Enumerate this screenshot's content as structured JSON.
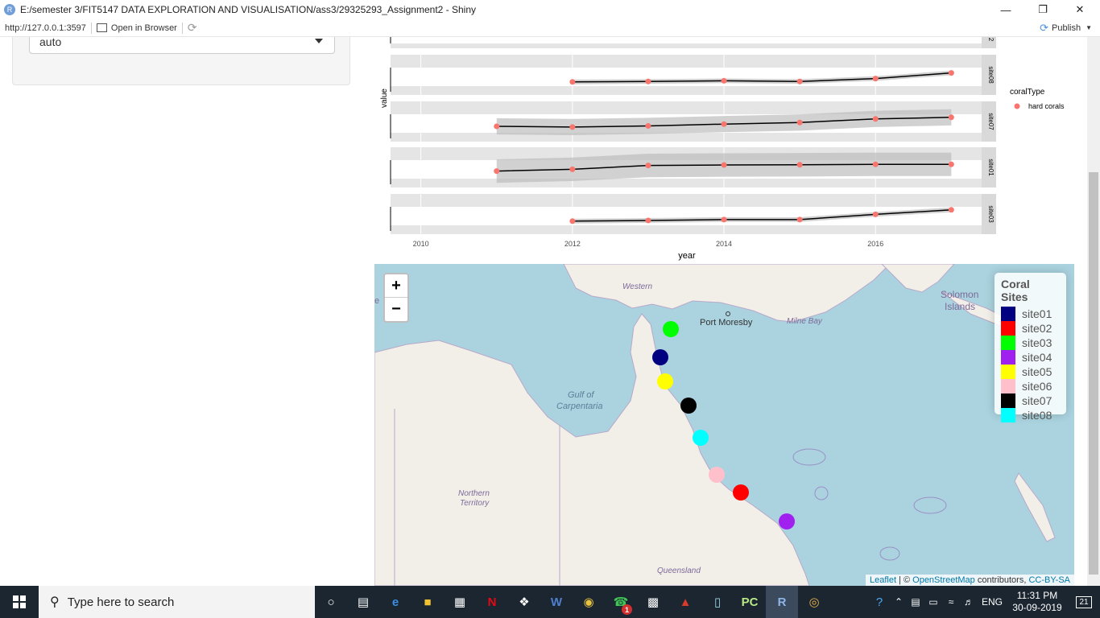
{
  "window": {
    "title": "E:/semester 3/FIT5147 DATA EXPLORATION AND VISUALISATION/ass3/29325293_Assignment2 - Shiny",
    "app_icon": "R",
    "controls": [
      "minimize-icon",
      "maximize-icon",
      "close-icon"
    ]
  },
  "addressbar": {
    "url": "http://127.0.0.1:3597",
    "open_in_browser": "Open in Browser",
    "publish": "Publish"
  },
  "sidebar": {
    "select_value": "auto"
  },
  "chart_data": {
    "type": "line",
    "xlabel": "year",
    "ylabel": "value",
    "x_ticks": [
      2010,
      2012,
      2014,
      2016
    ],
    "xlim": [
      2009.6,
      2017.4
    ],
    "facets": [
      "site08",
      "site07",
      "site01",
      "site03"
    ],
    "partial_facet_label_top": "2",
    "legend": {
      "title": "coralType",
      "entries": [
        {
          "label": "hard corals",
          "color": "#f8766d"
        }
      ]
    },
    "series": [
      {
        "facet": "site08",
        "x": [
          2012,
          2013,
          2014,
          2015,
          2016,
          2017
        ],
        "y": [
          0.15,
          0.17,
          0.2,
          0.17,
          0.3,
          0.55
        ],
        "band": 0.05
      },
      {
        "facet": "site07",
        "x": [
          2011,
          2012,
          2013,
          2014,
          2015,
          2016,
          2017
        ],
        "y": [
          0.25,
          0.22,
          0.27,
          0.35,
          0.42,
          0.58,
          0.65
        ],
        "band": 0.45
      },
      {
        "facet": "site01",
        "x": [
          2011,
          2012,
          2013,
          2014,
          2015,
          2016,
          2017
        ],
        "y": [
          0.3,
          0.38,
          0.55,
          0.57,
          0.58,
          0.6,
          0.6
        ],
        "band": 0.7
      },
      {
        "facet": "site03",
        "x": [
          2012,
          2013,
          2014,
          2015,
          2016,
          2017
        ],
        "y": [
          0.15,
          0.18,
          0.22,
          0.22,
          0.45,
          0.65
        ],
        "band": 0.05
      }
    ]
  },
  "map": {
    "zoom_in": "+",
    "zoom_out": "−",
    "legend_title": "Coral Sites",
    "sites": [
      {
        "label": "site01",
        "color": "#000080"
      },
      {
        "label": "site02",
        "color": "#ff0000"
      },
      {
        "label": "site03",
        "color": "#00ff00"
      },
      {
        "label": "site04",
        "color": "#a020f0"
      },
      {
        "label": "site05",
        "color": "#ffff00"
      },
      {
        "label": "site06",
        "color": "#ffc0cb"
      },
      {
        "label": "site07",
        "color": "#000000"
      },
      {
        "label": "site08",
        "color": "#00ffff"
      }
    ],
    "place_labels": {
      "western": "Western",
      "port_moresby": "Port Moresby",
      "milne_bay": "Milne Bay",
      "solomon": "Solomon",
      "islands": "Islands",
      "gulf_of": "Gulf of",
      "carpentaria": "Carpentaria",
      "northern": "Northern",
      "territory": "Territory",
      "queensland": "Queensland",
      "edge_e": "e"
    },
    "attribution": {
      "leaflet": "Leaflet",
      "sep": " | © ",
      "osm": "OpenStreetMap",
      "contributors": " contributors, ",
      "license": "CC-BY-SA"
    }
  },
  "taskbar": {
    "search_placeholder": "Type here to search",
    "apps": [
      "cortana-icon",
      "task-view-icon",
      "edge-icon",
      "file-explorer-icon",
      "store-icon",
      "netflix-icon",
      "dropbox-icon",
      "word-icon",
      "chrome-icon",
      "whatsapp-icon",
      "cmd-icon",
      "acrobat-icon",
      "notes-icon",
      "pycharm-icon",
      "rstudio-icon",
      "paint-icon"
    ],
    "whatsapp_badge": "1",
    "language": "ENG",
    "time": "11:31 PM",
    "date": "30-09-2019",
    "notifications": "21"
  }
}
